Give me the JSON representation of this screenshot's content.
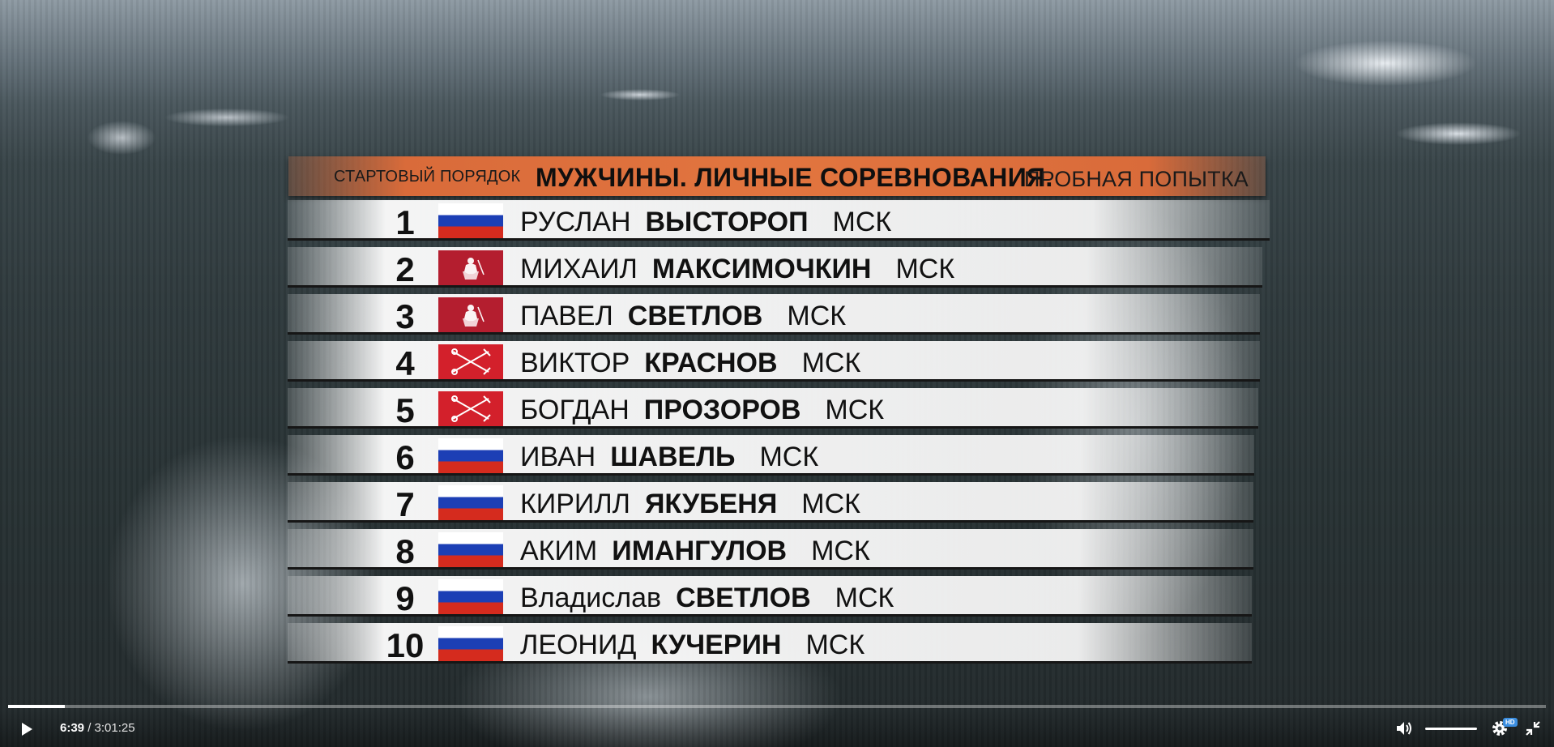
{
  "header": {
    "left": "СТАРТОВЫЙ ПОРЯДОК",
    "title": "МУЖЧИНЫ. ЛИЧНЫЕ СОРЕВНОВАНИЯ.",
    "subtitle": "ПРОБНАЯ ПОПЫТКА"
  },
  "athletes": [
    {
      "num": "1",
      "flag": "ru",
      "first": "РУСЛАН",
      "last": "ВЫСТОРОП",
      "region": "МСК"
    },
    {
      "num": "2",
      "flag": "msk",
      "first": "МИХАИЛ",
      "last": "МАКСИМОЧКИН",
      "region": "МСК"
    },
    {
      "num": "3",
      "flag": "msk",
      "first": "ПАВЕЛ",
      "last": "СВЕТЛОВ",
      "region": "МСК"
    },
    {
      "num": "4",
      "flag": "spb",
      "first": "ВИКТОР",
      "last": "КРАСНОВ",
      "region": "МСК"
    },
    {
      "num": "5",
      "flag": "spb",
      "first": "БОГДАН",
      "last": "ПРОЗОРОВ",
      "region": "МСК"
    },
    {
      "num": "6",
      "flag": "ru",
      "first": "ИВАН",
      "last": "ШАВЕЛЬ",
      "region": "МСК"
    },
    {
      "num": "7",
      "flag": "ru",
      "first": "КИРИЛЛ",
      "last": "ЯКУБЕНЯ",
      "region": "МСК"
    },
    {
      "num": "8",
      "flag": "ru",
      "first": "АКИМ",
      "last": "ИМАНГУЛОВ",
      "region": "МСК"
    },
    {
      "num": "9",
      "flag": "ru",
      "first": "Владислав",
      "last": "СВЕТЛОВ",
      "region": "МСК"
    },
    {
      "num": "10",
      "flag": "ru",
      "first": "ЛЕОНИД",
      "last": "КУЧЕРИН",
      "region": "МСК"
    }
  ],
  "player": {
    "current_time": "6:39",
    "separator": " / ",
    "duration": "3:01:25",
    "progress_fraction": 0.037,
    "volume_fraction": 1.0,
    "quality_badge": "HD",
    "icons": [
      "play-icon",
      "volume-icon",
      "gear-icon",
      "exit-fullscreen-icon"
    ]
  }
}
